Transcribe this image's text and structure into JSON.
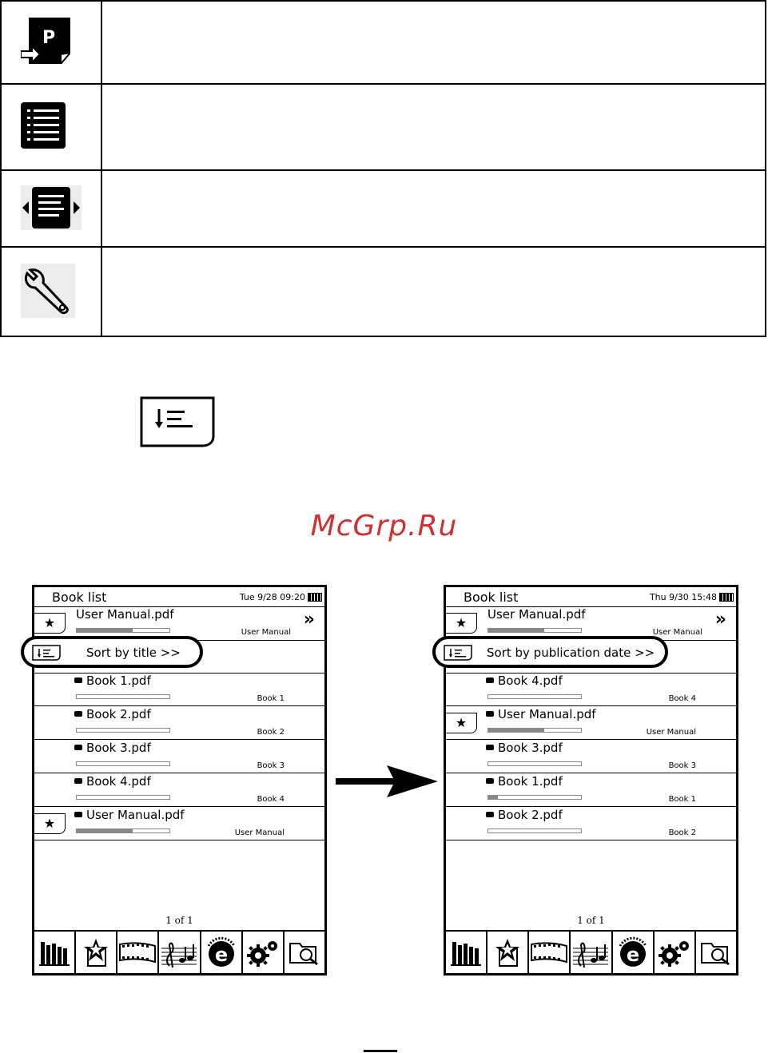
{
  "icon_table": {
    "rows": [
      {
        "icon": "parking-goto-page-icon",
        "description": ""
      },
      {
        "icon": "list-icon",
        "description": ""
      },
      {
        "icon": "page-width-icon",
        "description": ""
      },
      {
        "icon": "wrench-icon",
        "description": ""
      }
    ]
  },
  "sort_sample": {
    "icon": "sort-list-icon"
  },
  "watermark": "McGrp.Ru",
  "screens": [
    {
      "title": "Book list",
      "datetime": "Tue 9/28 09:20",
      "top_item": {
        "name": "User Manual.pdf",
        "author": "User Manual",
        "progress": 0.6
      },
      "sort_label": "Sort by title >>",
      "items": [
        {
          "name": "Book 1.pdf",
          "author": "Book 1",
          "progress": 0,
          "starred": false
        },
        {
          "name": "Book 2.pdf",
          "author": "Book 2",
          "progress": 0,
          "starred": false
        },
        {
          "name": "Book 3.pdf",
          "author": "Book 3",
          "progress": 0,
          "starred": false
        },
        {
          "name": "Book 4.pdf",
          "author": "Book 4",
          "progress": 0,
          "starred": false
        },
        {
          "name": "User Manual.pdf",
          "author": "User Manual",
          "progress": 0.6,
          "starred": true
        }
      ],
      "pager": "1 of 1"
    },
    {
      "title": "Book list",
      "datetime": "Thu 9/30 15:48",
      "top_item": {
        "name": "User Manual.pdf",
        "author": "User Manual",
        "progress": 0.6
      },
      "sort_label": "Sort by publication date >>",
      "items": [
        {
          "name": "Book 4.pdf",
          "author": "Book 4",
          "progress": 0,
          "starred": false
        },
        {
          "name": "User Manual.pdf",
          "author": "User Manual",
          "progress": 0.6,
          "starred": true
        },
        {
          "name": "Book 3.pdf",
          "author": "Book 3",
          "progress": 0,
          "starred": false
        },
        {
          "name": "Book 1.pdf",
          "author": "Book 1",
          "progress": 0.1,
          "starred": false
        },
        {
          "name": "Book 2.pdf",
          "author": "Book 2",
          "progress": 0,
          "starred": false
        }
      ],
      "pager": "1 of 1"
    }
  ],
  "tabbar": [
    "library-icon",
    "favorites-icon",
    "video-icon",
    "music-icon",
    "onextbook-icon",
    "settings-icon",
    "file-browser-icon"
  ]
}
